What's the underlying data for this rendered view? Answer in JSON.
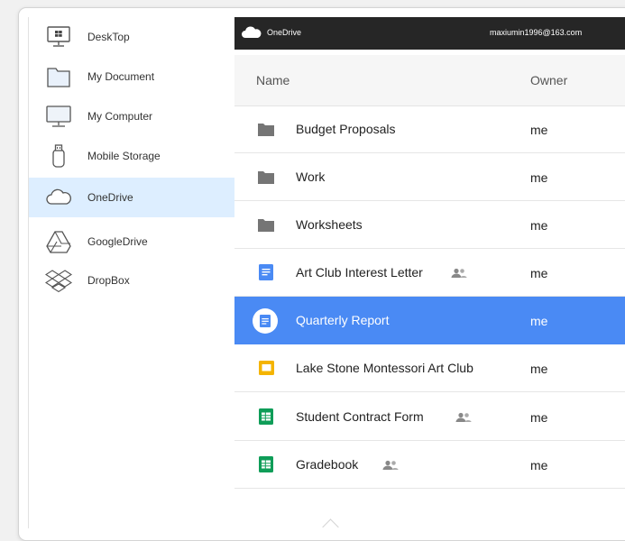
{
  "sidebar": {
    "items": [
      {
        "label": "DeskTop",
        "icon": "desktop-icon"
      },
      {
        "label": "My Document",
        "icon": "folder-icon"
      },
      {
        "label": "My Computer",
        "icon": "monitor-icon"
      },
      {
        "label": "Mobile Storage",
        "icon": "usb-drive-icon"
      },
      {
        "label": "OneDrive",
        "icon": "cloud-icon",
        "active": true
      },
      {
        "label": "GoogleDrive",
        "icon": "google-drive-icon"
      },
      {
        "label": "DropBox",
        "icon": "dropbox-icon"
      }
    ]
  },
  "topbar": {
    "title": "OneDrive",
    "user": "maxiumin1996@163.com"
  },
  "table": {
    "headers": {
      "name": "Name",
      "owner": "Owner"
    },
    "rows": [
      {
        "name": "Budget Proposals",
        "owner": "me",
        "type": "folder"
      },
      {
        "name": "Work",
        "owner": "me",
        "type": "folder"
      },
      {
        "name": "Worksheets",
        "owner": "me",
        "type": "folder"
      },
      {
        "name": "Art Club Interest Letter",
        "owner": "me",
        "type": "doc",
        "shared": true
      },
      {
        "name": "Quarterly Report",
        "owner": "me",
        "type": "doc",
        "selected": true
      },
      {
        "name": "Lake Stone Montessori Art Club",
        "owner": "me",
        "type": "slides"
      },
      {
        "name": "Student Contract Form",
        "owner": "me",
        "type": "sheet",
        "shared": true
      },
      {
        "name": "Gradebook",
        "owner": "me",
        "type": "sheet",
        "shared": true
      }
    ]
  },
  "colors": {
    "selected_row": "#4a8af4",
    "active_sidebar": "#ddeeff",
    "topbar": "#262626",
    "doc": "#4a8af4",
    "slides": "#f4b400",
    "sheet": "#0f9d58",
    "folder": "#757575"
  }
}
